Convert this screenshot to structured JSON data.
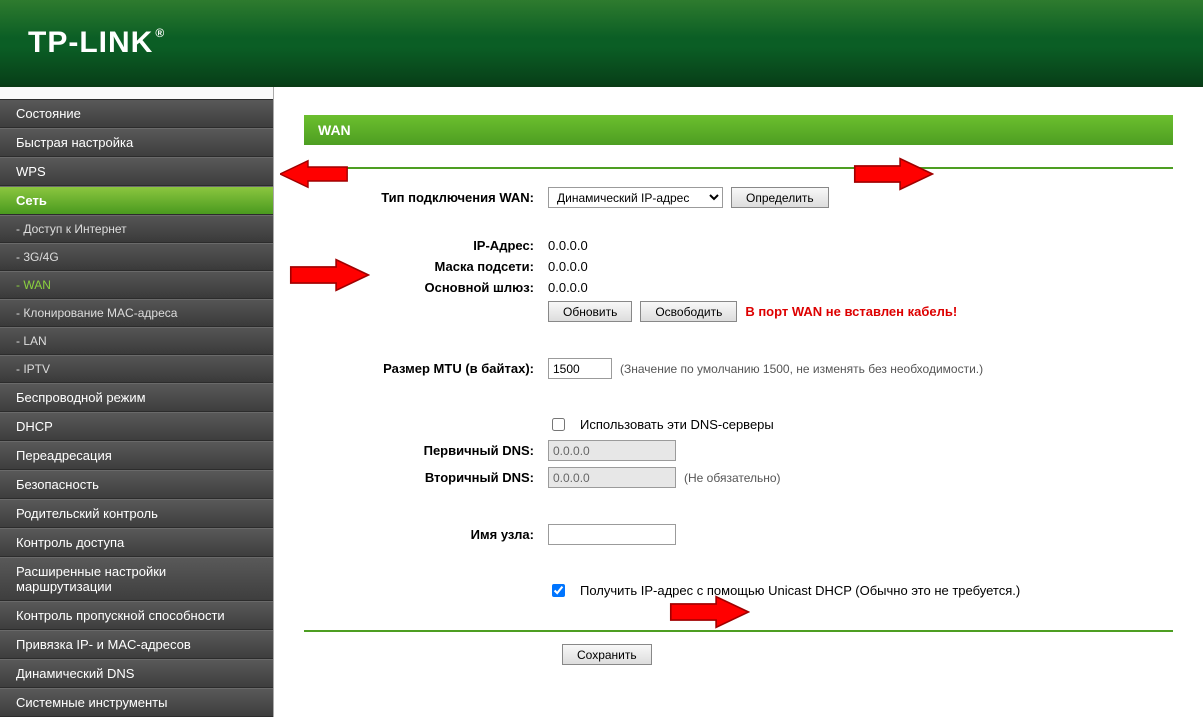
{
  "brand": "TP-LINK",
  "sidebar": {
    "items": [
      {
        "label": "Состояние",
        "type": "item"
      },
      {
        "label": "Быстрая настройка",
        "type": "item"
      },
      {
        "label": "WPS",
        "type": "item"
      },
      {
        "label": "Сеть",
        "type": "parent-active"
      },
      {
        "label": "- Доступ к Интернет",
        "type": "sub"
      },
      {
        "label": "- 3G/4G",
        "type": "sub"
      },
      {
        "label": "- WAN",
        "type": "sub-active"
      },
      {
        "label": "- Клонирование MAC-адреса",
        "type": "sub"
      },
      {
        "label": "- LAN",
        "type": "sub"
      },
      {
        "label": "- IPTV",
        "type": "sub"
      },
      {
        "label": "Беспроводной режим",
        "type": "item"
      },
      {
        "label": "DHCP",
        "type": "item"
      },
      {
        "label": "Переадресация",
        "type": "item"
      },
      {
        "label": "Безопасность",
        "type": "item"
      },
      {
        "label": "Родительский контроль",
        "type": "item"
      },
      {
        "label": "Контроль доступа",
        "type": "item"
      },
      {
        "label": "Расширенные настройки маршрутизации",
        "type": "item"
      },
      {
        "label": "Контроль пропускной способности",
        "type": "item"
      },
      {
        "label": "Привязка IP- и MAC-адресов",
        "type": "item"
      },
      {
        "label": "Динамический DNS",
        "type": "item"
      },
      {
        "label": "Системные инструменты",
        "type": "item"
      }
    ]
  },
  "page": {
    "title": "WAN",
    "wan_type_label": "Тип подключения WAN:",
    "wan_type_selected": "Динамический IP-адрес",
    "detect_btn": "Определить",
    "ip_label": "IP-Адрес:",
    "ip_value": "0.0.0.0",
    "mask_label": "Маска подсети:",
    "mask_value": "0.0.0.0",
    "gw_label": "Основной шлюз:",
    "gw_value": "0.0.0.0",
    "renew_btn": "Обновить",
    "release_btn": "Освободить",
    "no_cable_warn": "В порт WAN не вставлен кабель!",
    "mtu_label": "Размер MTU (в байтах):",
    "mtu_value": "1500",
    "mtu_hint": "(Значение по умолчанию 1500, не изменять без необходимости.)",
    "use_dns_label": "Использовать эти DNS-серверы",
    "dns1_label": "Первичный DNS:",
    "dns1_placeholder": "0.0.0.0",
    "dns2_label": "Вторичный DNS:",
    "dns2_placeholder": "0.0.0.0",
    "dns2_hint": "(Не обязательно)",
    "host_label": "Имя узла:",
    "host_value": "",
    "unicast_label": "Получить IP-адрес с помощью Unicast DHCP (Обычно это не требуется.)",
    "save_btn": "Сохранить"
  }
}
